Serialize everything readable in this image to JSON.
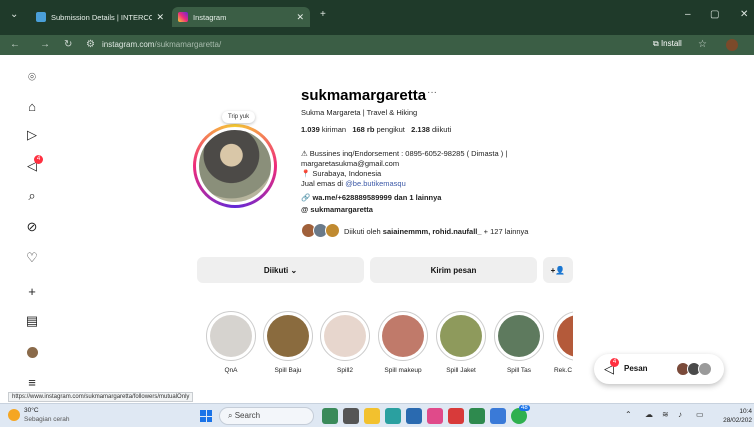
{
  "browser": {
    "tabs": [
      {
        "title": "Submission Details | INTERCON:",
        "active": false
      },
      {
        "title": "Instagram",
        "active": true
      }
    ],
    "url_host": "instagram.com",
    "url_path": "/sukmamargaretta/",
    "install_label": "Install",
    "status_url": "https://www.instagram.com/sukmamargaretta/followers/mutualOnly"
  },
  "sidebar": {
    "notification_count": "4",
    "icons": [
      "instagram-icon",
      "home-icon",
      "reels-icon",
      "messenger-icon",
      "search-icon",
      "explore-icon",
      "heart-icon",
      "create-icon",
      "dashboard-icon",
      "profile-icon",
      "menu-icon"
    ]
  },
  "profile": {
    "note": "Trip yuk",
    "username": "sukmamargaretta",
    "more": "···",
    "full_name": "Sukma Margareta | Travel & Hiking",
    "posts": "1.039",
    "posts_label": "kiriman",
    "followers": "168 rb",
    "followers_label": "pengikut",
    "following": "2.138",
    "following_label": "diikuti",
    "bio1": "⚠ Bussines inq/Endorsement : 0895-6052-98285 ( Dimasta ) |",
    "bio2": "margaretasukma@gmail.com",
    "bio3": "📍 Surabaya, Indonesia",
    "bio4_prefix": "Jual emas di ",
    "bio4_link": "@be.butikemasqu",
    "link": "wa.me/+628889589999 dan 1 lainnya",
    "threads": "sukmamargaretta",
    "followed_by_prefix": "Diikuti oleh ",
    "followed_by_names": "saiainemmm, rohid.naufall_",
    "followed_by_suffix": " + 127 lainnya"
  },
  "buttons": {
    "following": "Diikuti ⌄",
    "message": "Kirim pesan",
    "suggest": "+👤"
  },
  "highlights": [
    {
      "label": "QnA"
    },
    {
      "label": "Spill Baju"
    },
    {
      "label": "Spill2"
    },
    {
      "label": "Spill makeup"
    },
    {
      "label": "Spill Jaket"
    },
    {
      "label": "Spill Tas"
    },
    {
      "label": "Rek.C"
    }
  ],
  "messages": {
    "label": "Pesan",
    "count": "4"
  },
  "taskbar": {
    "temp": "30°C",
    "weather": "Sebagian cerah",
    "search": "Search",
    "badge": "48",
    "time": "10:4",
    "date": "28/02/202"
  }
}
